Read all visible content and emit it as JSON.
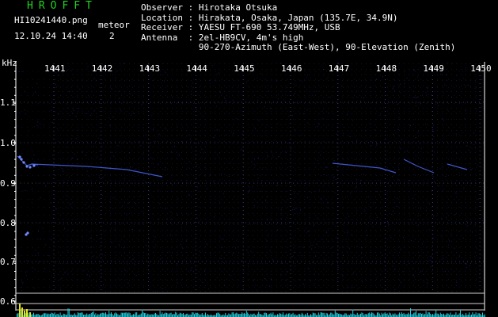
{
  "header": {
    "app_title": "HROFFT",
    "file_name": "HI10241440.png",
    "meteor_label": "meteor",
    "datetime": "12.10.24 14:40",
    "meteor_count": "2"
  },
  "info": [
    {
      "key": "Observer ",
      "value": "Hirotaka Otsuka"
    },
    {
      "key": "Location ",
      "value": "Hirakata, Osaka, Japan (135.7E, 34.9N)"
    },
    {
      "key": "Receiver ",
      "value": "YAESU FT-690 53.749MHz, USB"
    },
    {
      "key": "Antenna  ",
      "value": "2el-HB9CV, 4m's high"
    },
    {
      "key": "",
      "value": "90-270-Azimuth (East-West), 90-Elevation (Zenith)"
    }
  ],
  "axis": {
    "unit": "kHz",
    "time_ticks": [
      "1441",
      "1442",
      "1443",
      "1444",
      "1445",
      "1446",
      "1447",
      "1448",
      "1449",
      "1450"
    ],
    "freq_ticks": [
      "1.1",
      "1.0",
      "0.9",
      "0.8",
      "0.7",
      "0.6"
    ]
  },
  "colors": {
    "background": "#000000",
    "title": "#1fd61f",
    "text": "#ffffff",
    "grid": "#6b6bd6",
    "trail": "#4f6bff",
    "noise": "#1c1c7a",
    "level": "#1fd0e0"
  }
}
